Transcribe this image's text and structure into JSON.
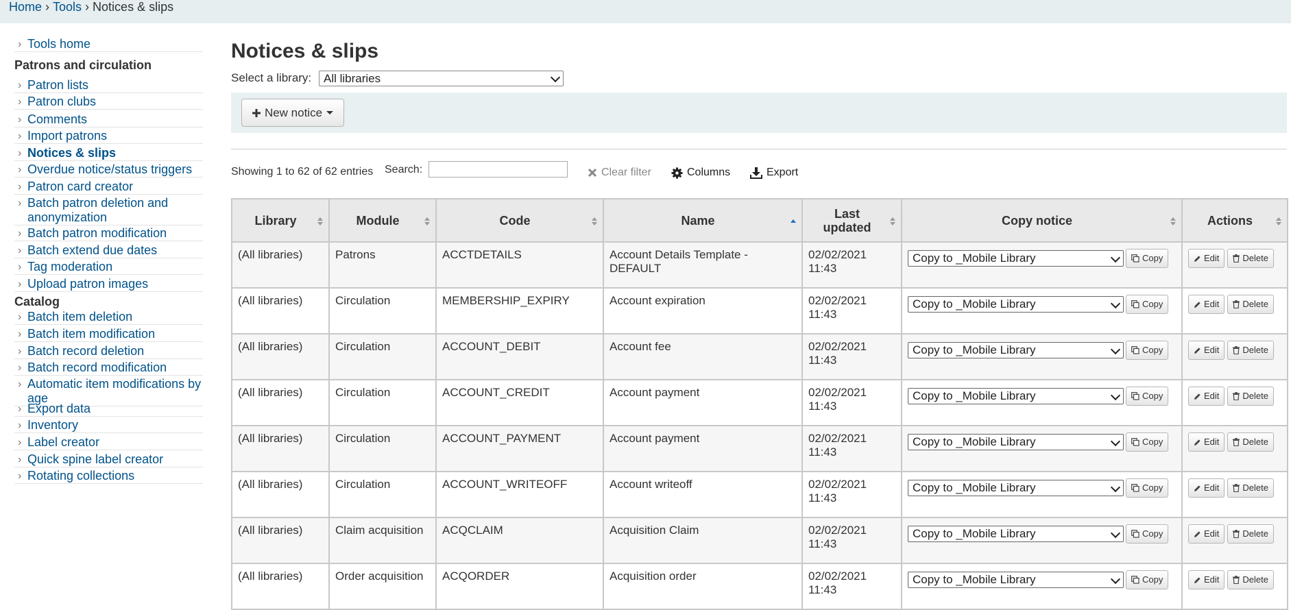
{
  "breadcrumb": {
    "home": "Home",
    "tools": "Tools",
    "current": "Notices & slips",
    "separator": "›"
  },
  "sidebar": {
    "top_items": [
      {
        "label": "Tools home"
      }
    ],
    "sections": [
      {
        "heading": "Patrons and circulation",
        "items": [
          {
            "label": "Patron lists"
          },
          {
            "label": "Patron clubs"
          },
          {
            "label": "Comments"
          },
          {
            "label": "Import patrons"
          },
          {
            "label": "Notices & slips",
            "active": true
          },
          {
            "label": "Overdue notice/status triggers"
          },
          {
            "label": "Patron card creator"
          },
          {
            "label": "Batch patron deletion and anonymization"
          },
          {
            "label": "Batch patron modification"
          },
          {
            "label": "Batch extend due dates"
          },
          {
            "label": "Tag moderation"
          },
          {
            "label": "Upload patron images"
          }
        ]
      },
      {
        "heading": "Catalog",
        "items": [
          {
            "label": "Batch item deletion"
          },
          {
            "label": "Batch item modification"
          },
          {
            "label": "Batch record deletion"
          },
          {
            "label": "Batch record modification"
          },
          {
            "label": "Automatic item modifications by age"
          },
          {
            "label": "Export data"
          },
          {
            "label": "Inventory"
          },
          {
            "label": "Label creator"
          },
          {
            "label": "Quick spine label creator"
          },
          {
            "label": "Rotating collections"
          }
        ]
      }
    ]
  },
  "main": {
    "title": "Notices & slips",
    "library_select": {
      "label": "Select a library:",
      "value": "All libraries"
    },
    "new_notice_label": "New notice",
    "info_text": "Showing 1 to 62 of 62 entries",
    "search_label": "Search:",
    "search_value": "",
    "clear_filter_label": "Clear filter",
    "columns_label": "Columns",
    "export_label": "Export"
  },
  "table": {
    "headers": {
      "library": "Library",
      "module": "Module",
      "code": "Code",
      "name": "Name",
      "updated_1": "Last",
      "updated_2": "updated",
      "copy": "Copy notice",
      "actions": "Actions"
    },
    "sorted_column": "name",
    "copy_label": "Copy",
    "edit_label": "Edit",
    "delete_label": "Delete",
    "rows": [
      {
        "library": "(All libraries)",
        "module": "Patrons",
        "code": "ACCTDETAILS",
        "name": "Account Details Template - DEFAULT",
        "date": "02/02/2021",
        "time": "11:43",
        "copy_to": "Copy to _Mobile Library"
      },
      {
        "library": "(All libraries)",
        "module": "Circulation",
        "code": "MEMBERSHIP_EXPIRY",
        "name": "Account expiration",
        "date": "02/02/2021",
        "time": "11:43",
        "copy_to": "Copy to _Mobile Library"
      },
      {
        "library": "(All libraries)",
        "module": "Circulation",
        "code": "ACCOUNT_DEBIT",
        "name": "Account fee",
        "date": "02/02/2021",
        "time": "11:43",
        "copy_to": "Copy to _Mobile Library"
      },
      {
        "library": "(All libraries)",
        "module": "Circulation",
        "code": "ACCOUNT_CREDIT",
        "name": "Account payment",
        "date": "02/02/2021",
        "time": "11:43",
        "copy_to": "Copy to _Mobile Library"
      },
      {
        "library": "(All libraries)",
        "module": "Circulation",
        "code": "ACCOUNT_PAYMENT",
        "name": "Account payment",
        "date": "02/02/2021",
        "time": "11:43",
        "copy_to": "Copy to _Mobile Library"
      },
      {
        "library": "(All libraries)",
        "module": "Circulation",
        "code": "ACCOUNT_WRITEOFF",
        "name": "Account writeoff",
        "date": "02/02/2021",
        "time": "11:43",
        "copy_to": "Copy to _Mobile Library"
      },
      {
        "library": "(All libraries)",
        "module": "Claim acquisition",
        "code": "ACQCLAIM",
        "name": "Acquisition Claim",
        "date": "02/02/2021",
        "time": "11:43",
        "copy_to": "Copy to _Mobile Library"
      },
      {
        "library": "(All libraries)",
        "module": "Order acquisition",
        "code": "ACQORDER",
        "name": "Acquisition order",
        "date": "02/02/2021",
        "time": "11:43",
        "copy_to": "Copy to _Mobile Library"
      }
    ]
  },
  "colors": {
    "link": "#00528a",
    "breadcrumb_bg": "#e6eef0",
    "toolbar_bg": "#e8f0f2",
    "header_bg": "#e9e9e9",
    "sort_active": "#1d6fb8"
  }
}
